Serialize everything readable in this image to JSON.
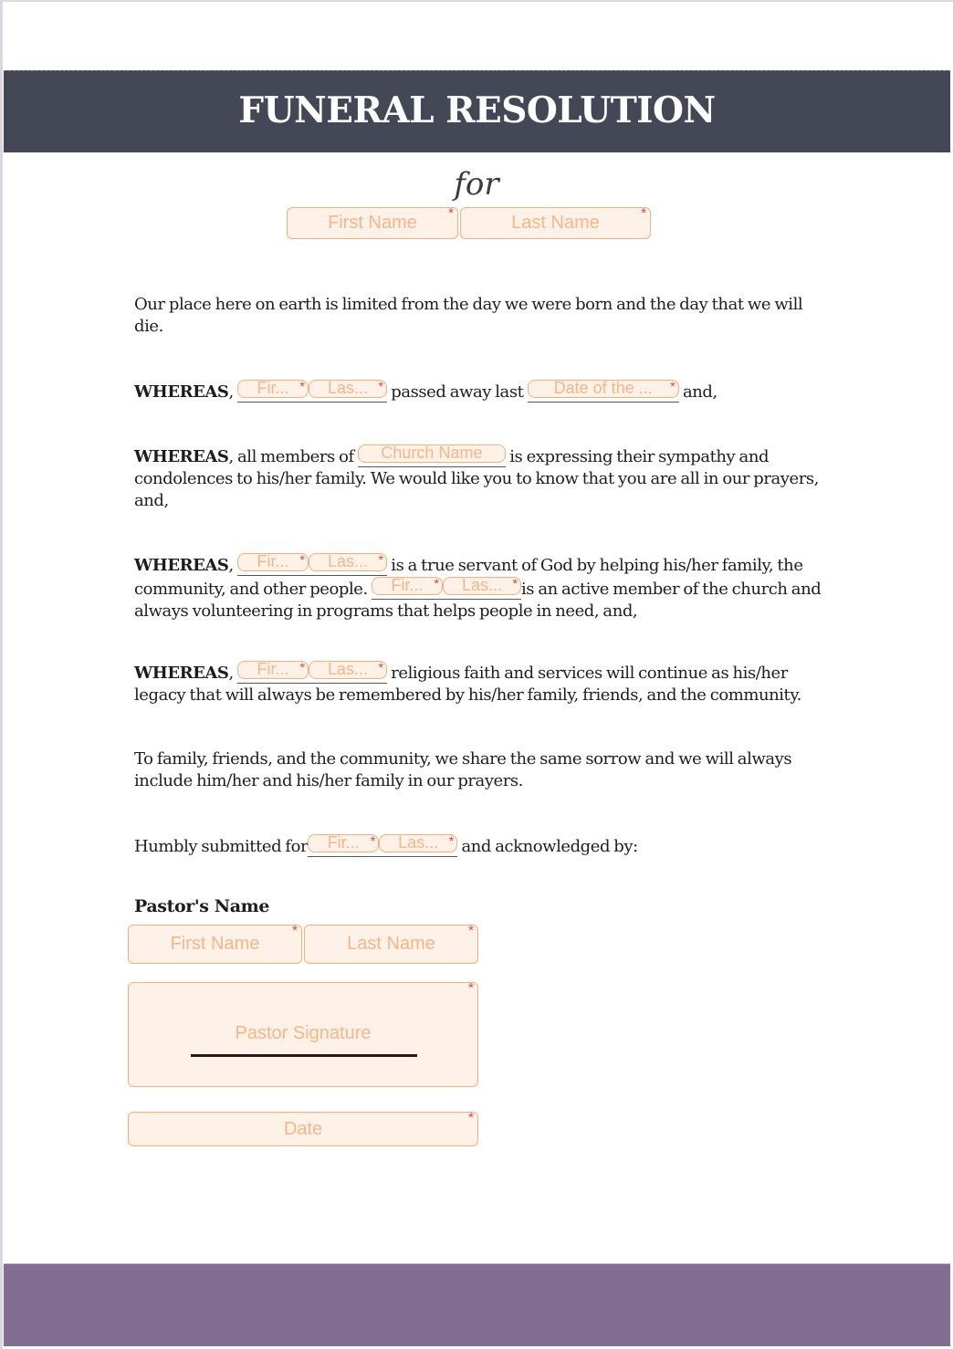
{
  "header": {
    "title": "FUNERAL RESOLUTION"
  },
  "subtitle": "for",
  "colors": {
    "header_band": "#444756",
    "footer_band": "#826e92",
    "field_border": "#f5b07a",
    "field_fill": "#fdf1e8",
    "field_placeholder": "#f7b688",
    "required_marker": "#e8423a"
  },
  "deceased_name": {
    "first_placeholder": "First Name",
    "last_placeholder": "Last Name",
    "required_mark": "*"
  },
  "inline_fields": {
    "first_short": "Fir...",
    "last_short": "Las...",
    "date_short": "Date of the ...",
    "church": "Church Name",
    "required_mark": "*"
  },
  "paragraphs": {
    "intro": "Our place here on earth is limited from the day we were born and the day that we will die.",
    "whereas_label": "WHEREAS",
    "p1": {
      "after_name": " passed away last ",
      "end": " and,"
    },
    "p2": {
      "before_church": ", all members of ",
      "after_church": " is expressing their sympathy and condolences to his/her family. We would like you to know that you are all in our prayers, and,"
    },
    "p3": {
      "after_name1": " is a true servant of God by helping his/her family, the community, and other people. ",
      "after_name2": "is an active member of the church and always volunteering in programs that helps people in need, and,"
    },
    "p4": {
      "after_name": " religious faith and services will continue as his/her legacy that will always be remembered by his/her family, friends, and the community."
    },
    "closing": "To family, friends, and the community, we share the same sorrow and we will always include him/her and his/her family in our prayers.",
    "submitted": {
      "before": "Humbly submitted for",
      "after": " and acknowledged by:"
    }
  },
  "pastor": {
    "section_label": "Pastor's Name",
    "first_placeholder": "First Name",
    "last_placeholder": "Last Name",
    "signature_placeholder": "Pastor Signature",
    "date_placeholder": "Date",
    "required_mark": "*"
  }
}
